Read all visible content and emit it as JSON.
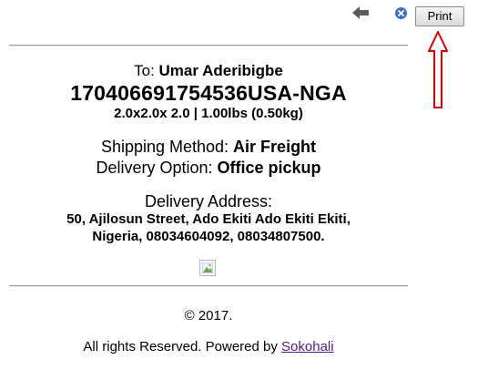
{
  "toolbar": {
    "back_icon": "back-arrow-icon",
    "close_icon": "close-circle-icon",
    "print_label": "Print",
    "annotation_arrow_color": "#e00000"
  },
  "label": {
    "to_prefix": "To: ",
    "recipient_name": "Umar Aderibigbe",
    "tracking_number": "170406691754536USA-NGA",
    "dimensions_weight": "2.0x2.0x 2.0 | 1.00lbs (0.50kg)",
    "shipping_method_label": "Shipping Method: ",
    "shipping_method_value": "Air Freight",
    "delivery_option_label": "Delivery Option: ",
    "delivery_option_value": "Office pickup",
    "delivery_address_title": "Delivery Address:",
    "delivery_address_line1": "50, Ajilosun Street, Ado Ekiti Ado Ekiti Ekiti,",
    "delivery_address_line2": "Nigeria, 08034604092, 08034807500."
  },
  "image": {
    "icon": "broken-image-icon"
  },
  "footer": {
    "copyright": "© 2017.",
    "rights_text": "All rights Reserved. Powered by ",
    "brand_link": "Sokohali"
  }
}
